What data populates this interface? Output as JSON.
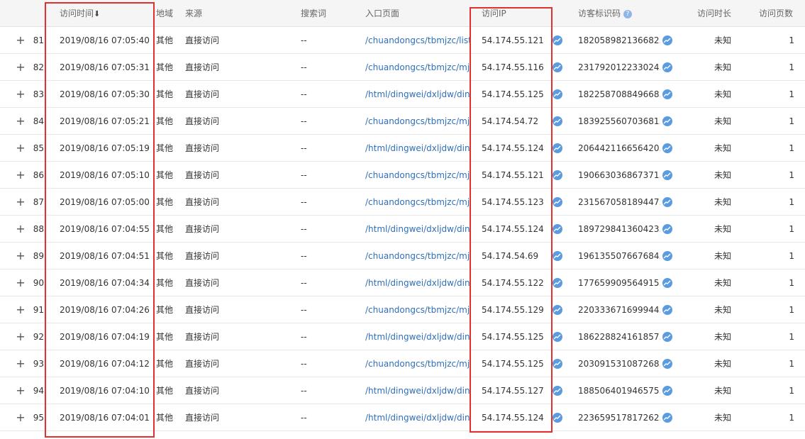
{
  "header": {
    "time": "访问时间",
    "sort_arrow": "⬇",
    "region": "地域",
    "source": "来源",
    "search": "搜索词",
    "page": "入口页面",
    "ip": "访问IP",
    "visitor_id": "访客标识码",
    "duration": "访问时长",
    "pages": "访问页数"
  },
  "colors": {
    "link": "#2f6fb8",
    "highlight": "#e03030",
    "trend_icon": "#5b9bdf"
  },
  "icons": {
    "expand": "plus-icon",
    "trend": "trend-chart-icon",
    "help": "question-help-icon"
  },
  "rows": [
    {
      "expand": "+",
      "index": "81",
      "time": "2019/08/16 07:05:40",
      "region": "其他",
      "source": "直接访问",
      "search": "--",
      "page": "/chuandongcs/tbmjzc/list...",
      "ip": "54.174.55.121",
      "visitor_id": "182058982136682...",
      "duration": "未知",
      "pages": "1"
    },
    {
      "expand": "+",
      "index": "82",
      "time": "2019/08/16 07:05:31",
      "region": "其他",
      "source": "直接访问",
      "search": "--",
      "page": "/chuandongcs/tbmjzc/mj...",
      "ip": "54.174.55.116",
      "visitor_id": "231792012233024...",
      "duration": "未知",
      "pages": "1"
    },
    {
      "expand": "+",
      "index": "83",
      "time": "2019/08/16 07:05:30",
      "region": "其他",
      "source": "直接访问",
      "search": "--",
      "page": "/html/dingwei/dxljdw/din...",
      "ip": "54.174.55.125",
      "visitor_id": "182258708849668...",
      "duration": "未知",
      "pages": "1"
    },
    {
      "expand": "+",
      "index": "84",
      "time": "2019/08/16 07:05:21",
      "region": "其他",
      "source": "直接访问",
      "search": "--",
      "page": "/chuandongcs/tbmjzc/mj...",
      "ip": "54.174.54.72",
      "visitor_id": "183925560703681...",
      "duration": "未知",
      "pages": "1"
    },
    {
      "expand": "+",
      "index": "85",
      "time": "2019/08/16 07:05:19",
      "region": "其他",
      "source": "直接访问",
      "search": "--",
      "page": "/html/dingwei/dxljdw/din...",
      "ip": "54.174.55.124",
      "visitor_id": "206442116656420...",
      "duration": "未知",
      "pages": "1"
    },
    {
      "expand": "+",
      "index": "86",
      "time": "2019/08/16 07:05:10",
      "region": "其他",
      "source": "直接访问",
      "search": "--",
      "page": "/chuandongcs/tbmjzc/mj...",
      "ip": "54.174.55.121",
      "visitor_id": "190663036867371...",
      "duration": "未知",
      "pages": "1"
    },
    {
      "expand": "+",
      "index": "87",
      "time": "2019/08/16 07:05:00",
      "region": "其他",
      "source": "直接访问",
      "search": "--",
      "page": "/chuandongcs/tbmjzc/mj...",
      "ip": "54.174.55.123",
      "visitor_id": "231567058189447...",
      "duration": "未知",
      "pages": "1"
    },
    {
      "expand": "+",
      "index": "88",
      "time": "2019/08/16 07:04:55",
      "region": "其他",
      "source": "直接访问",
      "search": "--",
      "page": "/html/dingwei/dxljdw/din...",
      "ip": "54.174.55.124",
      "visitor_id": "189729841360423...",
      "duration": "未知",
      "pages": "1"
    },
    {
      "expand": "+",
      "index": "89",
      "time": "2019/08/16 07:04:51",
      "region": "其他",
      "source": "直接访问",
      "search": "--",
      "page": "/chuandongcs/tbmjzc/mj...",
      "ip": "54.174.54.69",
      "visitor_id": "196135507667684...",
      "duration": "未知",
      "pages": "1"
    },
    {
      "expand": "+",
      "index": "90",
      "time": "2019/08/16 07:04:34",
      "region": "其他",
      "source": "直接访问",
      "search": "--",
      "page": "/html/dingwei/dxljdw/din...",
      "ip": "54.174.55.122",
      "visitor_id": "177659909564915...",
      "duration": "未知",
      "pages": "1"
    },
    {
      "expand": "+",
      "index": "91",
      "time": "2019/08/16 07:04:26",
      "region": "其他",
      "source": "直接访问",
      "search": "--",
      "page": "/chuandongcs/tbmjzc/mj...",
      "ip": "54.174.55.129",
      "visitor_id": "220333671699944...",
      "duration": "未知",
      "pages": "1"
    },
    {
      "expand": "+",
      "index": "92",
      "time": "2019/08/16 07:04:19",
      "region": "其他",
      "source": "直接访问",
      "search": "--",
      "page": "/html/dingwei/dxljdw/din...",
      "ip": "54.174.55.125",
      "visitor_id": "186228824161857...",
      "duration": "未知",
      "pages": "1"
    },
    {
      "expand": "+",
      "index": "93",
      "time": "2019/08/16 07:04:12",
      "region": "其他",
      "source": "直接访问",
      "search": "--",
      "page": "/chuandongcs/tbmjzc/mj...",
      "ip": "54.174.55.125",
      "visitor_id": "203091531087268...",
      "duration": "未知",
      "pages": "1"
    },
    {
      "expand": "+",
      "index": "94",
      "time": "2019/08/16 07:04:10",
      "region": "其他",
      "source": "直接访问",
      "search": "--",
      "page": "/html/dingwei/dxljdw/din...",
      "ip": "54.174.55.127",
      "visitor_id": "188506401946575...",
      "duration": "未知",
      "pages": "1"
    },
    {
      "expand": "+",
      "index": "95",
      "time": "2019/08/16 07:04:01",
      "region": "其他",
      "source": "直接访问",
      "search": "--",
      "page": "/html/dingwei/dxljdw/din...",
      "ip": "54.174.55.124",
      "visitor_id": "223659517817262...",
      "duration": "未知",
      "pages": "1"
    }
  ]
}
